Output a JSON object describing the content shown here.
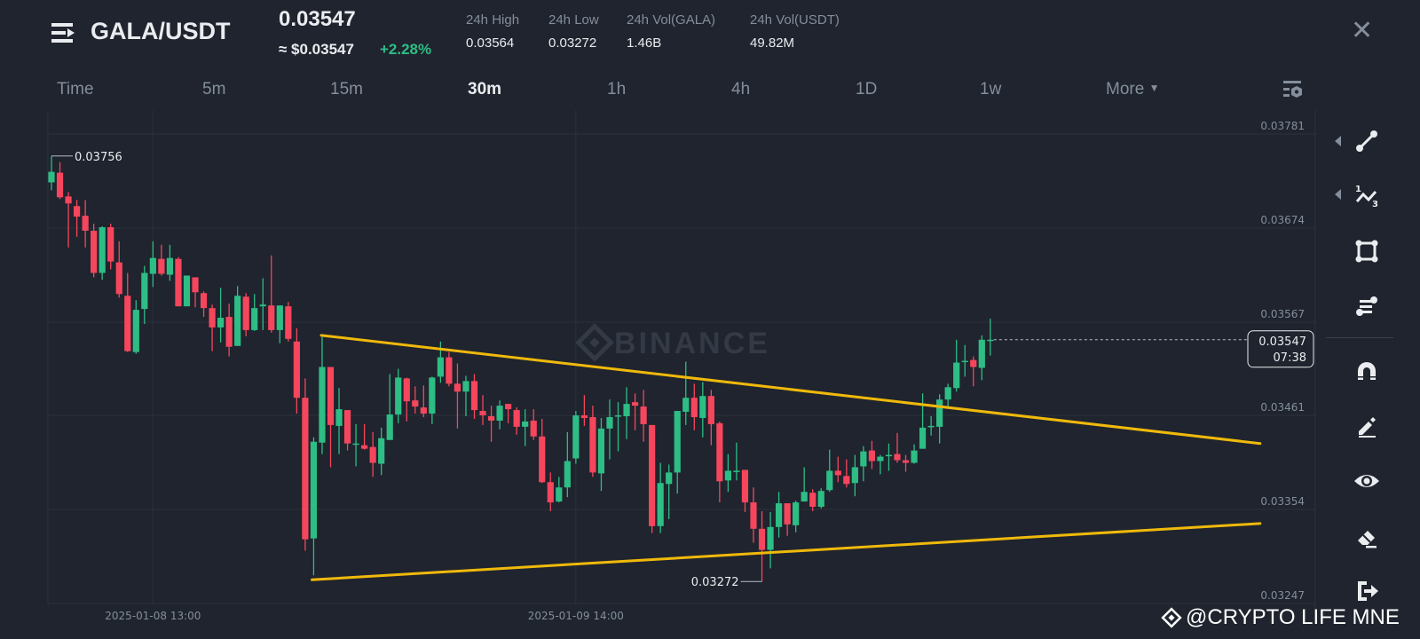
{
  "header": {
    "pair": "GALA/USDT",
    "last_price": "0.03547",
    "fiat_price": "≈ $0.03547",
    "change": "+2.28%",
    "stats": [
      {
        "label": "24h High",
        "value": "0.03564"
      },
      {
        "label": "24h Low",
        "value": "0.03272"
      },
      {
        "label": "24h Vol(GALA)",
        "value": "1.46B"
      },
      {
        "label": "24h Vol(USDT)",
        "value": "49.82M"
      }
    ],
    "close_icon": "close-icon"
  },
  "intervals": [
    {
      "label": "Time",
      "active": false
    },
    {
      "label": "5m",
      "active": false
    },
    {
      "label": "15m",
      "active": false
    },
    {
      "label": "30m",
      "active": true
    },
    {
      "label": "1h",
      "active": false
    },
    {
      "label": "4h",
      "active": false
    },
    {
      "label": "1D",
      "active": false
    },
    {
      "label": "1w",
      "active": false
    },
    {
      "label": "More",
      "active": false
    }
  ],
  "toolbar": [
    "trend-line-icon",
    "fib-icon",
    "rectangle-icon",
    "text-tool-icon",
    "magnet-icon",
    "pen-icon",
    "eye-icon",
    "eraser-icon",
    "exit-icon"
  ],
  "watermark": "@CRYPTO LIFE MNE",
  "exchange_watermark": "BINANCE",
  "colors": {
    "bg": "#1f242e",
    "up": "#2ebd85",
    "down": "#f6465d",
    "trendline": "#f0b90b",
    "grid": "#2b313b"
  },
  "chart_data": {
    "type": "candlestick",
    "interval": "30m",
    "ylim": [
      0.03247,
      0.03781
    ],
    "y_ticks": [
      "0.03781",
      "0.03674",
      "0.03567",
      "0.03461",
      "0.03354",
      "0.03247"
    ],
    "x_ticks": [
      {
        "index": 13,
        "label": "2025-01-08 13:00"
      },
      {
        "index": 63,
        "label": "2025-01-09 14:00"
      }
    ],
    "high_marker": {
      "index": 1,
      "label": "0.03756"
    },
    "low_marker": {
      "index": 85,
      "label": "0.03272"
    },
    "current": {
      "price": "0.03547",
      "countdown": "07:38"
    },
    "trendlines": [
      {
        "name": "upper",
        "from": [
          32.9,
          0.03552
        ],
        "to": [
          143.9,
          0.03429
        ]
      },
      {
        "name": "lower",
        "from": [
          31.8,
          0.03274
        ],
        "to": [
          143.9,
          0.03338
        ]
      }
    ],
    "candles_ohlc": [
      [
        0.03726,
        0.03756,
        0.03717,
        0.03738
      ],
      [
        0.03737,
        0.03749,
        0.03707,
        0.03709
      ],
      [
        0.0371,
        0.03715,
        0.03652,
        0.03702
      ],
      [
        0.03699,
        0.03706,
        0.03664,
        0.03687
      ],
      [
        0.03688,
        0.03706,
        0.03652,
        0.03671
      ],
      [
        0.03671,
        0.03679,
        0.03618,
        0.03623
      ],
      [
        0.03623,
        0.03676,
        0.03615,
        0.03675
      ],
      [
        0.03675,
        0.03679,
        0.03627,
        0.03636
      ],
      [
        0.03635,
        0.03659,
        0.03595,
        0.03599
      ],
      [
        0.03597,
        0.03623,
        0.03533,
        0.03534
      ],
      [
        0.03533,
        0.03592,
        0.03531,
        0.03581
      ],
      [
        0.03582,
        0.03631,
        0.03565,
        0.03623
      ],
      [
        0.03622,
        0.03659,
        0.03607,
        0.0364
      ],
      [
        0.03639,
        0.03655,
        0.0362,
        0.03622
      ],
      [
        0.03621,
        0.03655,
        0.03614,
        0.0364
      ],
      [
        0.03639,
        0.03641,
        0.03585,
        0.03585
      ],
      [
        0.03585,
        0.0362,
        0.03585,
        0.0362
      ],
      [
        0.03618,
        0.03618,
        0.03584,
        0.03601
      ],
      [
        0.036,
        0.03602,
        0.03573,
        0.03583
      ],
      [
        0.03583,
        0.03587,
        0.03534,
        0.03561
      ],
      [
        0.03561,
        0.03606,
        0.03544,
        0.03572
      ],
      [
        0.03573,
        0.03588,
        0.03528,
        0.03539
      ],
      [
        0.0354,
        0.03608,
        0.0354,
        0.03597
      ],
      [
        0.03596,
        0.036,
        0.03551,
        0.03558
      ],
      [
        0.03558,
        0.03599,
        0.03557,
        0.03583
      ],
      [
        0.03585,
        0.03617,
        0.03558,
        0.03587
      ],
      [
        0.03586,
        0.03643,
        0.03555,
        0.03558
      ],
      [
        0.03558,
        0.03586,
        0.03543,
        0.03586
      ],
      [
        0.03585,
        0.0359,
        0.03545,
        0.03548
      ],
      [
        0.03545,
        0.0356,
        0.03463,
        0.03481
      ],
      [
        0.03481,
        0.03503,
        0.03307,
        0.0332
      ],
      [
        0.03321,
        0.03436,
        0.03279,
        0.03431
      ],
      [
        0.0343,
        0.0355,
        0.03417,
        0.03516
      ],
      [
        0.03516,
        0.03516,
        0.03402,
        0.0345
      ],
      [
        0.03449,
        0.03492,
        0.03417,
        0.03468
      ],
      [
        0.03467,
        0.03467,
        0.03421,
        0.03429
      ],
      [
        0.03429,
        0.03451,
        0.03403,
        0.03429
      ],
      [
        0.03427,
        0.03451,
        0.03422,
        0.03423
      ],
      [
        0.03425,
        0.03442,
        0.03391,
        0.03407
      ],
      [
        0.03406,
        0.03447,
        0.03393,
        0.03435
      ],
      [
        0.03433,
        0.03508,
        0.03433,
        0.03462
      ],
      [
        0.03462,
        0.03514,
        0.03452,
        0.03504
      ],
      [
        0.03503,
        0.03504,
        0.03454,
        0.03477
      ],
      [
        0.03478,
        0.03494,
        0.03463,
        0.03471
      ],
      [
        0.0347,
        0.03495,
        0.03459,
        0.03463
      ],
      [
        0.03463,
        0.03505,
        0.03451,
        0.03504
      ],
      [
        0.03505,
        0.03545,
        0.03498,
        0.03527
      ],
      [
        0.03527,
        0.03533,
        0.03494,
        0.03497
      ],
      [
        0.03497,
        0.0352,
        0.03446,
        0.03488
      ],
      [
        0.03488,
        0.03506,
        0.0346,
        0.035
      ],
      [
        0.035,
        0.03508,
        0.03457,
        0.03467
      ],
      [
        0.03466,
        0.03484,
        0.0345,
        0.03461
      ],
      [
        0.0346,
        0.03472,
        0.03431,
        0.03455
      ],
      [
        0.03455,
        0.03478,
        0.03445,
        0.03472
      ],
      [
        0.03474,
        0.03474,
        0.03452,
        0.03468
      ],
      [
        0.03467,
        0.0347,
        0.03439,
        0.03448
      ],
      [
        0.03448,
        0.03468,
        0.03426,
        0.03454
      ],
      [
        0.03455,
        0.03468,
        0.03433,
        0.03437
      ],
      [
        0.03437,
        0.03457,
        0.03384,
        0.03385
      ],
      [
        0.03385,
        0.03396,
        0.03352,
        0.03362
      ],
      [
        0.03363,
        0.03391,
        0.03362,
        0.03379
      ],
      [
        0.03379,
        0.03442,
        0.03368,
        0.03409
      ],
      [
        0.03412,
        0.03466,
        0.03406,
        0.03461
      ],
      [
        0.03461,
        0.03484,
        0.03449,
        0.03458
      ],
      [
        0.03459,
        0.03472,
        0.03391,
        0.03396
      ],
      [
        0.03395,
        0.03458,
        0.03375,
        0.03446
      ],
      [
        0.03446,
        0.03479,
        0.03411,
        0.03459
      ],
      [
        0.0346,
        0.03476,
        0.0342,
        0.03461
      ],
      [
        0.0346,
        0.03493,
        0.03434,
        0.03474
      ],
      [
        0.03476,
        0.03486,
        0.03444,
        0.03472
      ],
      [
        0.03471,
        0.0349,
        0.03431,
        0.03451
      ],
      [
        0.0345,
        0.0345,
        0.03327,
        0.03335
      ],
      [
        0.03335,
        0.03407,
        0.03327,
        0.03384
      ],
      [
        0.03383,
        0.03405,
        0.03343,
        0.03396
      ],
      [
        0.03396,
        0.03466,
        0.03372,
        0.03466
      ],
      [
        0.03465,
        0.03522,
        0.0345,
        0.03481
      ],
      [
        0.03481,
        0.03497,
        0.03444,
        0.03459
      ],
      [
        0.03458,
        0.03499,
        0.03436,
        0.03483
      ],
      [
        0.03483,
        0.0349,
        0.03427,
        0.03451
      ],
      [
        0.03452,
        0.03454,
        0.03362,
        0.03386
      ],
      [
        0.03387,
        0.03417,
        0.03374,
        0.03398
      ],
      [
        0.03398,
        0.0343,
        0.03387,
        0.03398
      ],
      [
        0.03399,
        0.03399,
        0.03351,
        0.03362
      ],
      [
        0.03362,
        0.03379,
        0.03316,
        0.03332
      ],
      [
        0.03332,
        0.03352,
        0.03272,
        0.03308
      ],
      [
        0.03308,
        0.03351,
        0.03287,
        0.03334
      ],
      [
        0.03334,
        0.03374,
        0.03322,
        0.03361
      ],
      [
        0.03361,
        0.03361,
        0.03324,
        0.03337
      ],
      [
        0.03336,
        0.03364,
        0.03328,
        0.03362
      ],
      [
        0.03363,
        0.03402,
        0.03363,
        0.03374
      ],
      [
        0.03373,
        0.03377,
        0.03352,
        0.03357
      ],
      [
        0.03357,
        0.03378,
        0.03355,
        0.03375
      ],
      [
        0.03376,
        0.03422,
        0.03374,
        0.03398
      ],
      [
        0.03398,
        0.03414,
        0.03385,
        0.03393
      ],
      [
        0.03392,
        0.03411,
        0.03379,
        0.03383
      ],
      [
        0.03384,
        0.03416,
        0.03369,
        0.03402
      ],
      [
        0.03403,
        0.03426,
        0.03386,
        0.0342
      ],
      [
        0.03421,
        0.03432,
        0.034,
        0.03409
      ],
      [
        0.03409,
        0.03416,
        0.03394,
        0.03414
      ],
      [
        0.03416,
        0.03429,
        0.03398,
        0.03416
      ],
      [
        0.03417,
        0.03441,
        0.03407,
        0.0341
      ],
      [
        0.0341,
        0.03416,
        0.03397,
        0.03407
      ],
      [
        0.03407,
        0.03428,
        0.03406,
        0.03421
      ],
      [
        0.03423,
        0.03486,
        0.03423,
        0.03447
      ],
      [
        0.03448,
        0.0346,
        0.03438,
        0.03449
      ],
      [
        0.03448,
        0.03485,
        0.03429,
        0.03479
      ],
      [
        0.03479,
        0.03497,
        0.0347,
        0.03493
      ],
      [
        0.03492,
        0.03547,
        0.03488,
        0.03521
      ],
      [
        0.03522,
        0.03541,
        0.03505,
        0.03523
      ],
      [
        0.03524,
        0.03528,
        0.03494,
        0.03516
      ],
      [
        0.03515,
        0.03552,
        0.03501,
        0.03547
      ],
      [
        0.03547,
        0.03571,
        0.03529,
        0.03547
      ]
    ]
  }
}
